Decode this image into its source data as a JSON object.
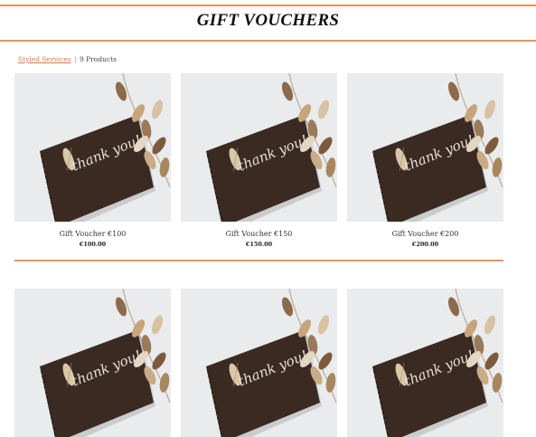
{
  "header": {
    "title": "GIFT VOUCHERS"
  },
  "breadcrumb": {
    "category": "Styled Services",
    "separator": "|",
    "count": "9 Products"
  },
  "product_image_text": "thank you!",
  "products": [
    {
      "name": "Gift Voucher €100",
      "price": "€100.00"
    },
    {
      "name": "Gift Voucher €150",
      "price": "€150.00"
    },
    {
      "name": "Gift Voucher €200",
      "price": "€200.00"
    },
    {
      "name": "",
      "price": ""
    },
    {
      "name": "",
      "price": ""
    },
    {
      "name": "",
      "price": ""
    }
  ],
  "colors": {
    "accent": "#e8955f",
    "link": "#d9774a",
    "card_bg": "#e9ebec",
    "notebook": "#3a2a22"
  }
}
